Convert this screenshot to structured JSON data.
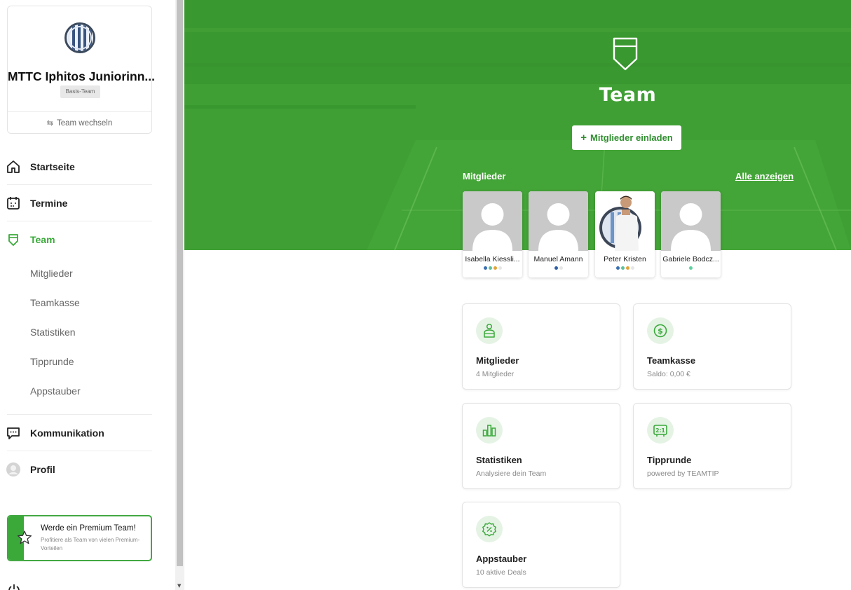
{
  "team": {
    "name": "MTTC Iphitos Juniorinn...",
    "badge": "Basis-Team",
    "switch_label": "Team wechseln"
  },
  "nav": {
    "home": "Startseite",
    "dates": "Termine",
    "team": "Team",
    "sub": [
      "Mitglieder",
      "Teamkasse",
      "Statistiken",
      "Tipprunde",
      "Appstauber"
    ],
    "communication": "Kommunikation",
    "profile": "Profil"
  },
  "premium": {
    "title": "Werde ein Premium Team!",
    "text": "Profitiere als Team von vielen Premium-Vorteilen"
  },
  "hero": {
    "title": "Team",
    "invite_label": "Mitglieder einladen",
    "members_label": "Mitglieder",
    "all_label": "Alle anzeigen"
  },
  "members": [
    {
      "name": "Isabella Kiessli...",
      "dots": [
        "#3a6fb0",
        "#5fbf9a",
        "#e0a43a",
        "#e6e6e6"
      ]
    },
    {
      "name": "Manuel Amann",
      "dots": [
        "#2e5fa8",
        "#e6e6e6"
      ]
    },
    {
      "name": "Peter Kristen",
      "dots": [
        "#3a6fb0",
        "#5fbf9a",
        "#e0a43a",
        "#e6e6e6"
      ]
    },
    {
      "name": "Gabriele Bodcz...",
      "dots": [
        "#5fd0a0"
      ]
    }
  ],
  "features": [
    {
      "title": "Mitglieder",
      "sub": "4 Mitglieder",
      "icon": "person-icon"
    },
    {
      "title": "Teamkasse",
      "sub": "Saldo: 0,00 €",
      "icon": "coin-icon"
    },
    {
      "title": "Statistiken",
      "sub": "Analysiere dein Team",
      "icon": "chart-icon"
    },
    {
      "title": "Tipprunde",
      "sub": "powered by TEAMTIP",
      "icon": "scoreboard-icon"
    },
    {
      "title": "Appstauber",
      "sub": "10 aktive Deals",
      "icon": "discount-icon"
    }
  ],
  "colors": {
    "accent": "#3aa93a",
    "hero_green": "#3e9e33",
    "icon_bg": "#e5f3e5"
  }
}
